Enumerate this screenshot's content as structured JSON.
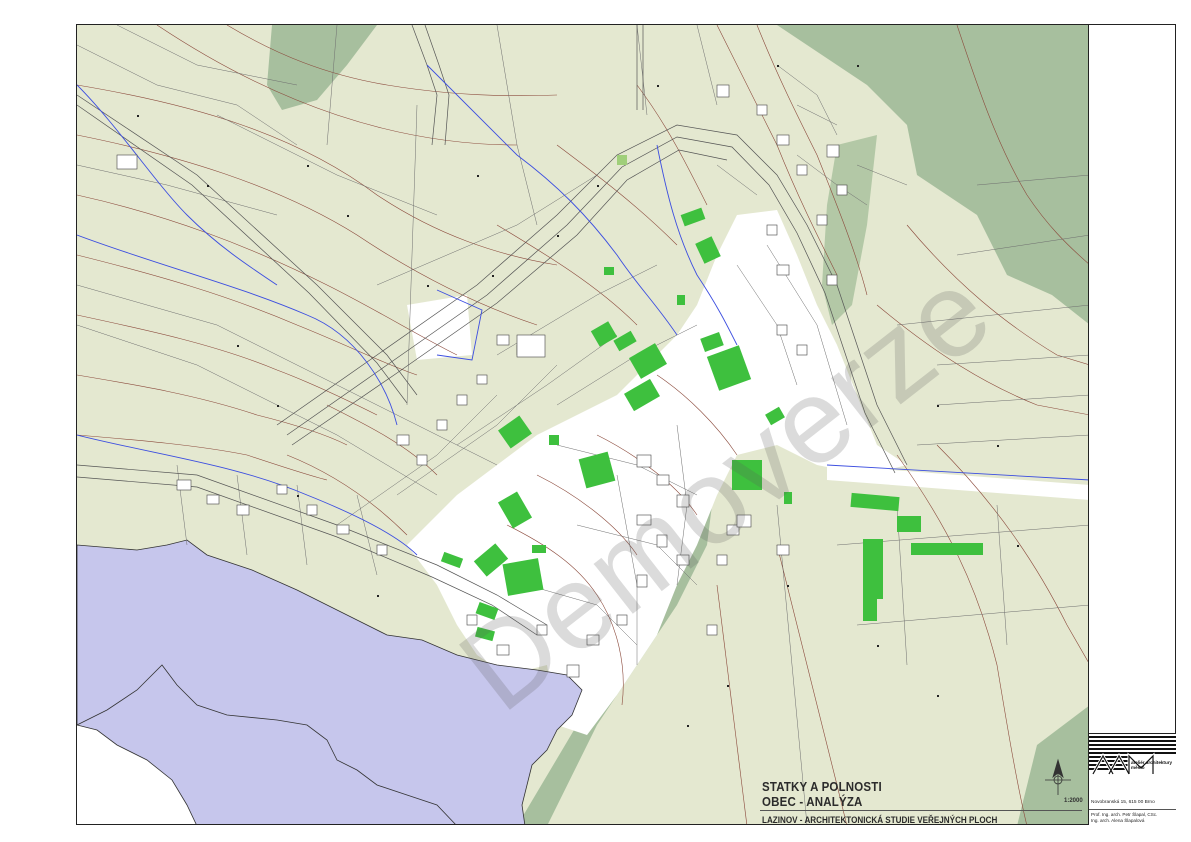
{
  "title": {
    "line1": "STATKY A POLNOSTI",
    "line2": "OBEC -  ANALÝZA",
    "subtitle": "LAZINOV - ARCHITEKTONICKÁ STUDIE VEŘEJNÝCH PLOCH"
  },
  "scale": "1:2000",
  "watermark": "Demoverze",
  "firm": {
    "name": "ateliér architektury město",
    "address": "Novobranská 15,  615 00  Brno",
    "people": "Prof. Ing. arch. Petr Šlapal, CSc.\nIng. arch. Alena Šlapalová"
  },
  "colors": {
    "background": "#e4e8d0",
    "built_area": "#ffffff",
    "forest": "#a7bf9e",
    "water": "#c6c6ec",
    "farmsteads": "#3ec03e",
    "contour": "#8b4a3c",
    "stream": "#3c4ee0",
    "parcel": "#6e6e6e"
  }
}
